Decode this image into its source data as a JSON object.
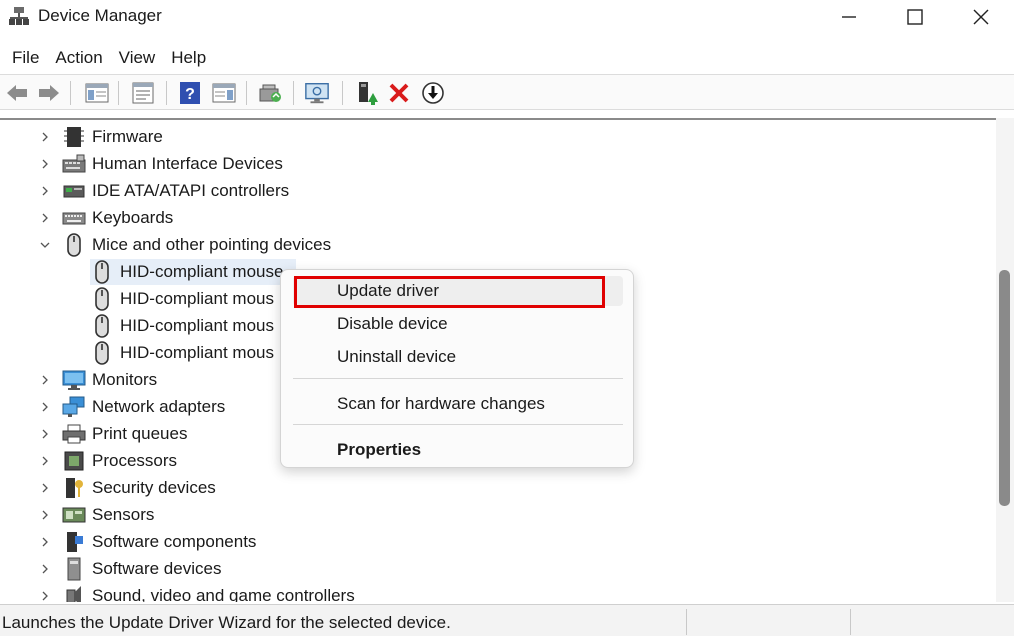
{
  "window": {
    "title": "Device Manager"
  },
  "menubar": {
    "items": [
      "File",
      "Action",
      "View",
      "Help"
    ]
  },
  "toolbar": {
    "buttons": [
      "back-arrow",
      "forward-arrow",
      "show-hide-console-tree",
      "properties",
      "help",
      "action-pane",
      "scan-hardware",
      "display-monitor",
      "update-driver",
      "uninstall",
      "disable"
    ]
  },
  "tree": {
    "categories": [
      {
        "label": "Firmware",
        "icon": "firmware-icon",
        "expanded": false
      },
      {
        "label": "Human Interface Devices",
        "icon": "hid-icon",
        "expanded": false
      },
      {
        "label": "IDE ATA/ATAPI controllers",
        "icon": "ide-controller-icon",
        "expanded": false
      },
      {
        "label": "Keyboards",
        "icon": "keyboard-icon",
        "expanded": false
      },
      {
        "label": "Mice and other pointing devices",
        "icon": "mouse-icon",
        "expanded": true
      },
      {
        "label": "Monitors",
        "icon": "monitor-icon",
        "expanded": false
      },
      {
        "label": "Network adapters",
        "icon": "network-icon",
        "expanded": false
      },
      {
        "label": "Print queues",
        "icon": "printer-icon",
        "expanded": false
      },
      {
        "label": "Processors",
        "icon": "processor-icon",
        "expanded": false
      },
      {
        "label": "Security devices",
        "icon": "security-icon",
        "expanded": false
      },
      {
        "label": "Sensors",
        "icon": "sensor-icon",
        "expanded": false
      },
      {
        "label": "Software components",
        "icon": "software-component-icon",
        "expanded": false
      },
      {
        "label": "Software devices",
        "icon": "software-device-icon",
        "expanded": false
      },
      {
        "label": "Sound, video and game controllers",
        "icon": "sound-icon",
        "expanded": false
      }
    ],
    "mice_children": [
      "HID-compliant mouse",
      "HID-compliant mous",
      "HID-compliant mous",
      "HID-compliant mous"
    ]
  },
  "context_menu": {
    "items": [
      "Update driver",
      "Disable device",
      "Uninstall device",
      "Scan for hardware changes",
      "Properties"
    ],
    "highlighted": "Update driver"
  },
  "statusbar": {
    "text": "Launches the Update Driver Wizard for the selected device."
  },
  "colors": {
    "highlight_box": "#e00000",
    "selection": "#e6eef8"
  }
}
